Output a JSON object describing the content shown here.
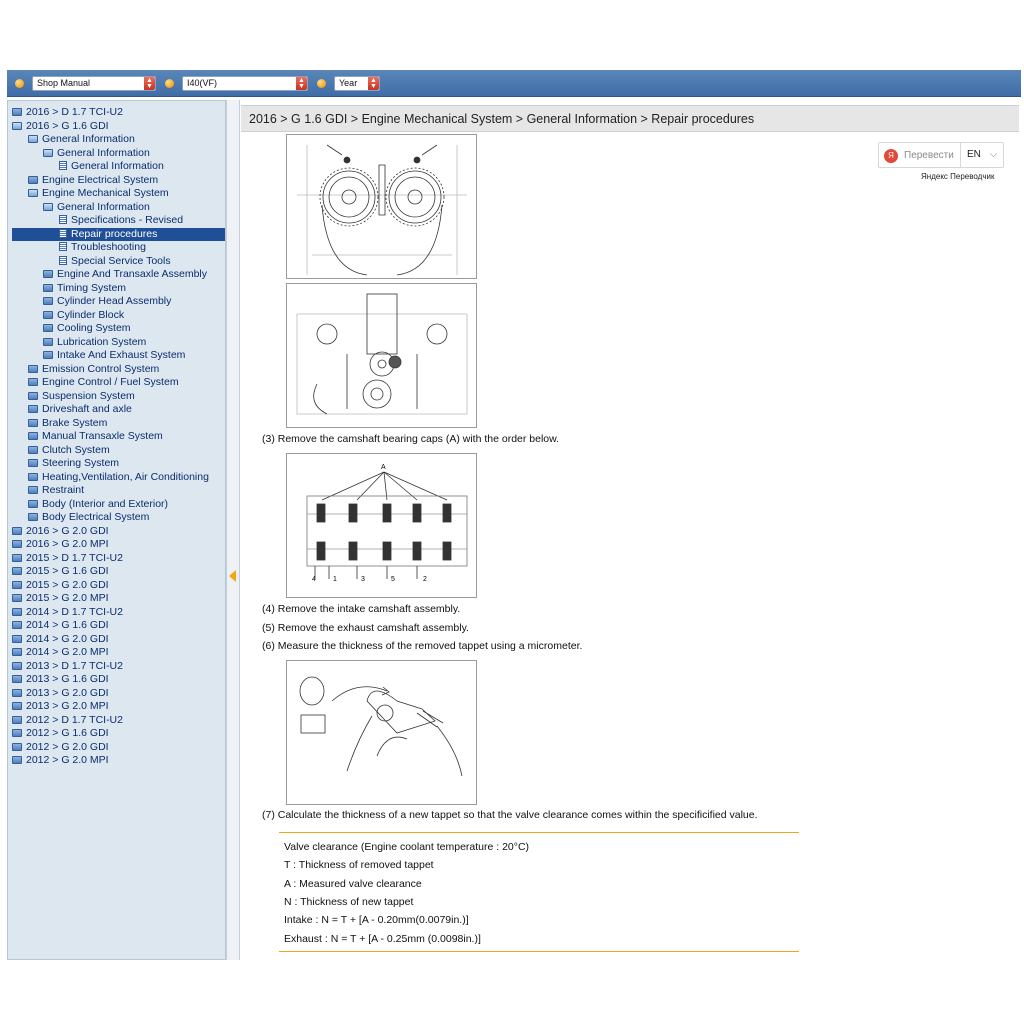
{
  "toolbar": {
    "manual_select": "Shop Manual",
    "model_select": "I40(VF)",
    "year_select": "Year"
  },
  "sidebar": {
    "items": [
      {
        "label": "2016 > D 1.7 TCI-U2",
        "depth": 0,
        "kind": "folder"
      },
      {
        "label": "2016 > G 1.6 GDI",
        "depth": 0,
        "kind": "open"
      },
      {
        "label": "General Information",
        "depth": 1,
        "kind": "open"
      },
      {
        "label": "General Information",
        "depth": 2,
        "kind": "open"
      },
      {
        "label": "General Information",
        "depth": 3,
        "kind": "doc"
      },
      {
        "label": "Engine Electrical System",
        "depth": 1,
        "kind": "folder"
      },
      {
        "label": "Engine Mechanical System",
        "depth": 1,
        "kind": "open"
      },
      {
        "label": "General Information",
        "depth": 2,
        "kind": "open"
      },
      {
        "label": "Specifications - Revised",
        "depth": 3,
        "kind": "doc"
      },
      {
        "label": "Repair procedures",
        "depth": 3,
        "kind": "doc",
        "selected": true
      },
      {
        "label": "Troubleshooting",
        "depth": 3,
        "kind": "doc"
      },
      {
        "label": "Special Service Tools",
        "depth": 3,
        "kind": "doc"
      },
      {
        "label": "Engine And Transaxle Assembly",
        "depth": 2,
        "kind": "folder"
      },
      {
        "label": "Timing System",
        "depth": 2,
        "kind": "folder"
      },
      {
        "label": "Cylinder Head Assembly",
        "depth": 2,
        "kind": "folder"
      },
      {
        "label": "Cylinder Block",
        "depth": 2,
        "kind": "folder"
      },
      {
        "label": "Cooling System",
        "depth": 2,
        "kind": "folder"
      },
      {
        "label": "Lubrication System",
        "depth": 2,
        "kind": "folder"
      },
      {
        "label": "Intake And Exhaust System",
        "depth": 2,
        "kind": "folder"
      },
      {
        "label": "Emission Control System",
        "depth": 1,
        "kind": "folder"
      },
      {
        "label": "Engine Control / Fuel System",
        "depth": 1,
        "kind": "folder"
      },
      {
        "label": "Suspension System",
        "depth": 1,
        "kind": "folder"
      },
      {
        "label": "Driveshaft and axle",
        "depth": 1,
        "kind": "folder"
      },
      {
        "label": "Brake System",
        "depth": 1,
        "kind": "folder"
      },
      {
        "label": "Manual Transaxle System",
        "depth": 1,
        "kind": "folder"
      },
      {
        "label": "Clutch System",
        "depth": 1,
        "kind": "folder"
      },
      {
        "label": "Steering System",
        "depth": 1,
        "kind": "folder"
      },
      {
        "label": "Heating,Ventilation, Air Conditioning",
        "depth": 1,
        "kind": "folder"
      },
      {
        "label": "Restraint",
        "depth": 1,
        "kind": "folder"
      },
      {
        "label": "Body (Interior and Exterior)",
        "depth": 1,
        "kind": "folder"
      },
      {
        "label": "Body Electrical System",
        "depth": 1,
        "kind": "folder"
      },
      {
        "label": "2016 > G 2.0 GDI",
        "depth": 0,
        "kind": "folder"
      },
      {
        "label": "2016 > G 2.0 MPI",
        "depth": 0,
        "kind": "folder"
      },
      {
        "label": "2015 > D 1.7 TCI-U2",
        "depth": 0,
        "kind": "folder"
      },
      {
        "label": "2015 > G 1.6 GDI",
        "depth": 0,
        "kind": "folder"
      },
      {
        "label": "2015 > G 2.0 GDI",
        "depth": 0,
        "kind": "folder"
      },
      {
        "label": "2015 > G 2.0 MPI",
        "depth": 0,
        "kind": "folder"
      },
      {
        "label": "2014 > D 1.7 TCI-U2",
        "depth": 0,
        "kind": "folder"
      },
      {
        "label": "2014 > G 1.6 GDI",
        "depth": 0,
        "kind": "folder"
      },
      {
        "label": "2014 > G 2.0 GDI",
        "depth": 0,
        "kind": "folder"
      },
      {
        "label": "2014 > G 2.0 MPI",
        "depth": 0,
        "kind": "folder"
      },
      {
        "label": "2013 > D 1.7 TCI-U2",
        "depth": 0,
        "kind": "folder"
      },
      {
        "label": "2013 > G 1.6 GDI",
        "depth": 0,
        "kind": "folder"
      },
      {
        "label": "2013 > G 2.0 GDI",
        "depth": 0,
        "kind": "folder"
      },
      {
        "label": "2013 > G 2.0 MPI",
        "depth": 0,
        "kind": "folder"
      },
      {
        "label": "2012 > D 1.7 TCI-U2",
        "depth": 0,
        "kind": "folder"
      },
      {
        "label": "2012 > G 1.6 GDI",
        "depth": 0,
        "kind": "folder"
      },
      {
        "label": "2012 > G 2.0 GDI",
        "depth": 0,
        "kind": "folder"
      },
      {
        "label": "2012 > G 2.0 MPI",
        "depth": 0,
        "kind": "folder"
      }
    ]
  },
  "content": {
    "breadcrumb": "2016 > G 1.6 GDI > Engine Mechanical System > General Information > Repair procedures",
    "translate_button": "Перевести",
    "translate_lang": "EN",
    "translate_provider": "Яндекс Переводчик",
    "figure_label_a": "A",
    "cap_numbers": [
      "4",
      "1",
      "3",
      "5",
      "2"
    ],
    "step3": "(3) Remove the camshaft bearing caps (A) with the order below.",
    "step4": "(4) Remove the intake camshaft assembly.",
    "step5": "(5) Remove the exhaust camshaft assembly.",
    "step6": "(6) Measure the thickness of the removed tappet using a micrometer.",
    "step7": "(7) Calculate the thickness of a new tappet so that the valve clearance comes within the specificified value.",
    "note": {
      "line1": "Valve clearance (Engine coolant temperature : 20°C)",
      "line2": "T : Thickness of removed tappet",
      "line3": "A : Measured valve clearance",
      "line4": "N : Thickness of new tappet",
      "line5": "Intake : N = T + [A - 0.20mm(0.0079in.)]",
      "line6": "Exhaust : N = T + [A - 0.25mm (0.0098in.)]"
    }
  },
  "colors": {
    "toolbar": "#4a78b0",
    "sidebar_bg": "#dde7f0",
    "selected_row": "#1f4f96",
    "accent_orange": "#f0a81a",
    "crumb_bg": "#e6e6e6"
  }
}
